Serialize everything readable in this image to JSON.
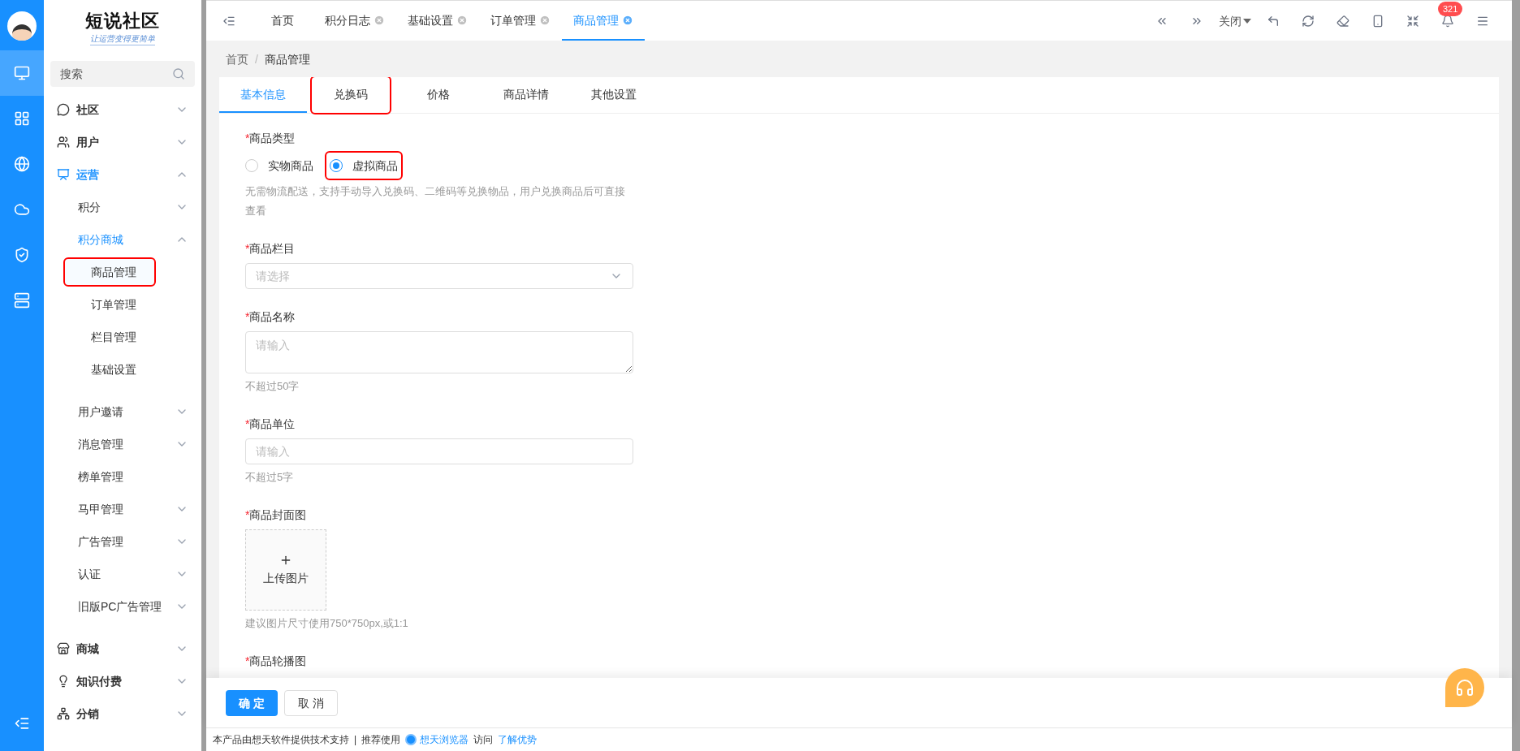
{
  "rail": {
    "items": [
      {
        "kind": "monitor",
        "selected": true
      },
      {
        "kind": "grid",
        "selected": false
      },
      {
        "kind": "globe",
        "selected": false
      },
      {
        "kind": "cloud",
        "selected": false
      },
      {
        "kind": "shield",
        "selected": false
      },
      {
        "kind": "cloud-box",
        "selected": false
      }
    ]
  },
  "logo": {
    "title": "短说社区",
    "slogan": "让运营变得更简单"
  },
  "search": {
    "placeholder": "搜索"
  },
  "sidebar": {
    "items": [
      {
        "label": "社区",
        "kind": "chat",
        "expanded": false,
        "selected": false
      },
      {
        "label": "用户",
        "kind": "users",
        "expanded": false,
        "selected": false
      },
      {
        "label": "运营",
        "kind": "board",
        "expanded": true,
        "selected": true,
        "children": [
          {
            "label": "积分",
            "expanded": false,
            "selected": false
          },
          {
            "label": "积分商城",
            "expanded": true,
            "selected": true,
            "children": [
              {
                "label": "商品管理",
                "selected": true,
                "highlighted": true
              },
              {
                "label": "订单管理",
                "selected": false,
                "highlighted": false
              },
              {
                "label": "栏目管理",
                "selected": false,
                "highlighted": false
              },
              {
                "label": "基础设置",
                "selected": false,
                "highlighted": false
              }
            ]
          },
          {
            "label": "用户邀请",
            "expanded": false,
            "selected": false
          },
          {
            "label": "消息管理",
            "expanded": false,
            "selected": false
          },
          {
            "label": "榜单管理",
            "selected": false,
            "leaf": true
          },
          {
            "label": "马甲管理",
            "expanded": false,
            "selected": false
          },
          {
            "label": "广告管理",
            "expanded": false,
            "selected": false
          },
          {
            "label": "认证",
            "expanded": false,
            "selected": false
          },
          {
            "label": "旧版PC广告管理",
            "expanded": false,
            "selected": false
          }
        ]
      },
      {
        "label": "商城",
        "kind": "store",
        "expanded": false,
        "selected": false
      },
      {
        "label": "知识付费",
        "kind": "bulb",
        "expanded": false,
        "selected": false
      },
      {
        "label": "分销",
        "kind": "network",
        "expanded": false,
        "selected": false
      }
    ]
  },
  "page_tabs": [
    {
      "label": "首页",
      "closable": false,
      "selected": false
    },
    {
      "label": "积分日志",
      "closable": true,
      "selected": false
    },
    {
      "label": "基础设置",
      "closable": true,
      "selected": false
    },
    {
      "label": "订单管理",
      "closable": true,
      "selected": false
    },
    {
      "label": "商品管理",
      "closable": true,
      "selected": true
    }
  ],
  "toolbar": {
    "close_menu": "关闭",
    "notifications": "321"
  },
  "breadcrumb": {
    "separator": "/",
    "items": [
      "首页",
      "商品管理"
    ]
  },
  "form_tabs": [
    {
      "label": "基本信息",
      "selected": true,
      "highlighted": false
    },
    {
      "label": "兑换码",
      "selected": false,
      "highlighted": true
    },
    {
      "label": "价格",
      "selected": false,
      "highlighted": false
    },
    {
      "label": "商品详情",
      "selected": false,
      "highlighted": false
    },
    {
      "label": "其他设置",
      "selected": false,
      "highlighted": false
    }
  ],
  "fields": [
    {
      "kind": "radio",
      "label": "商品类型",
      "required_mark": "*",
      "options": [
        {
          "label": "实物商品",
          "selected": false,
          "highlighted": false
        },
        {
          "label": "虚拟商品",
          "selected": true,
          "highlighted": true
        }
      ],
      "hint": "无需物流配送，支持手动导入兑换码、二维码等兑换物品，用户兑换商品后可直接查看"
    },
    {
      "kind": "select",
      "label": "商品栏目",
      "required_mark": "*",
      "placeholder": "请选择"
    },
    {
      "kind": "textarea",
      "label": "商品名称",
      "required_mark": "*",
      "placeholder": "请输入",
      "hint": "不超过50字"
    },
    {
      "kind": "input",
      "label": "商品单位",
      "required_mark": "*",
      "placeholder": "请输入",
      "hint": "不超过5字"
    },
    {
      "kind": "upload",
      "label": "商品封面图",
      "required_mark": "*",
      "button": "上传图片",
      "hint": "建议图片尺寸使用750*750px,或1:1"
    },
    {
      "kind": "label",
      "label": "商品轮播图",
      "required_mark": "*"
    }
  ],
  "actions": [
    {
      "label": "确 定",
      "kind": "primary"
    },
    {
      "label": "取 消",
      "kind": "default"
    }
  ],
  "footer": [
    {
      "text": "本产品由想天软件提供技术支持",
      "kind": "text"
    },
    {
      "text": "|",
      "kind": "text"
    },
    {
      "text": "推荐使用",
      "kind": "text"
    },
    {
      "text": "想天浏览器",
      "kind": "browser-link"
    },
    {
      "text": "访问",
      "kind": "text"
    },
    {
      "text": "了解优势",
      "kind": "link"
    }
  ]
}
